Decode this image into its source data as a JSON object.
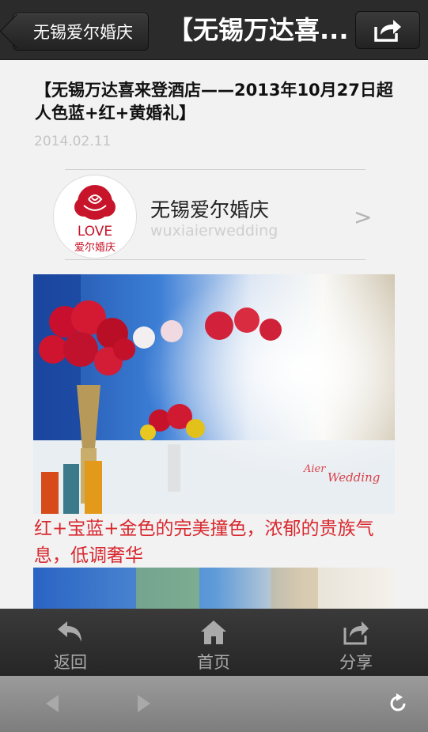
{
  "header": {
    "back_label": "无锡爱尔婚庆",
    "title": "【无锡万达喜..."
  },
  "article": {
    "title": "【无锡万达喜来登酒店——2013年10月27日超人色蓝+红+黄婚礼】",
    "date": "2014.02.11",
    "caption": "红+宝蓝+金色的完美撞色，浓郁的贵族气息，低调奢华"
  },
  "account": {
    "logo_line1": "LOVE",
    "logo_line2": "爱尔婚庆",
    "name": "无锡爱尔婚庆",
    "id": "wuxiaierwedding",
    "chevron": ">"
  },
  "photo": {
    "watermark_line1": "Aier",
    "watermark_line2": "Wedding"
  },
  "tabbar": {
    "back": "返回",
    "home": "首页",
    "share": "分享"
  },
  "colors": {
    "accent_red": "#d8282f",
    "bar_dark": "#2b2b2b"
  },
  "icons": [
    "share-icon",
    "back-arrow-icon",
    "home-icon",
    "share-icon",
    "browser-back-icon",
    "browser-forward-icon",
    "reload-icon"
  ]
}
